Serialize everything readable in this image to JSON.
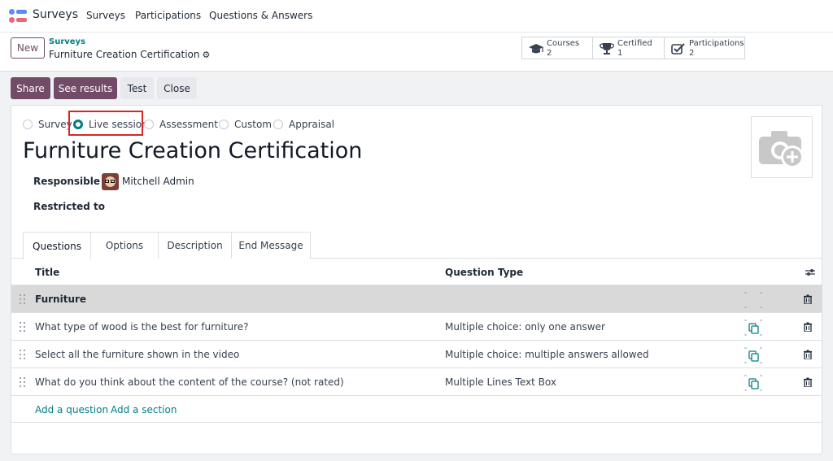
{
  "app": {
    "name": "Surveys",
    "logo_colors": [
      "#e46a76",
      "#5b8def",
      "#f7c948"
    ]
  },
  "nav": {
    "items": [
      {
        "label": "Surveys"
      },
      {
        "label": "Participations"
      },
      {
        "label": "Questions & Answers"
      }
    ]
  },
  "control_panel": {
    "new_label": "New",
    "breadcrumb_parent": "Surveys",
    "breadcrumb_current": "Furniture Creation Certification",
    "stats": [
      {
        "label": "Courses",
        "value": "2",
        "icon": "graduation-cap-icon"
      },
      {
        "label": "Certified",
        "value": "1",
        "icon": "trophy-icon"
      },
      {
        "label": "Participations",
        "value": "2",
        "icon": "checkbox-edit-icon"
      }
    ]
  },
  "actions": {
    "share": "Share",
    "see_results": "See results",
    "test": "Test",
    "close": "Close"
  },
  "form": {
    "survey_types": [
      {
        "label": "Survey",
        "checked": false
      },
      {
        "label": "Live session",
        "checked": true
      },
      {
        "label": "Assessment",
        "checked": false
      },
      {
        "label": "Custom",
        "checked": false
      },
      {
        "label": "Appraisal",
        "checked": false
      }
    ],
    "title": "Furniture Creation Certification",
    "responsible_label": "Responsible",
    "responsible_value": "Mitchell Admin",
    "restricted_label": "Restricted to"
  },
  "tabs": [
    {
      "label": "Questions",
      "active": true
    },
    {
      "label": "Options",
      "active": false
    },
    {
      "label": "Description",
      "active": false
    },
    {
      "label": "End Message",
      "active": false
    }
  ],
  "table": {
    "col_title": "Title",
    "col_type": "Question Type",
    "rows": [
      {
        "title": "Furniture",
        "type": "",
        "is_section": true
      },
      {
        "title": "What type of wood is the best for furniture?",
        "type": "Multiple choice: only one answer",
        "is_section": false
      },
      {
        "title": "Select all the furniture shown in the video",
        "type": "Multiple choice: multiple answers allowed",
        "is_section": false
      },
      {
        "title": "What do you think about the content of the course? (not rated)",
        "type": "Multiple Lines Text Box",
        "is_section": false
      }
    ],
    "add_question": "Add a question",
    "add_section": "Add a section"
  },
  "colors": {
    "primary": "#714b67",
    "accent": "#017e84",
    "highlight_box": "#d62728"
  }
}
